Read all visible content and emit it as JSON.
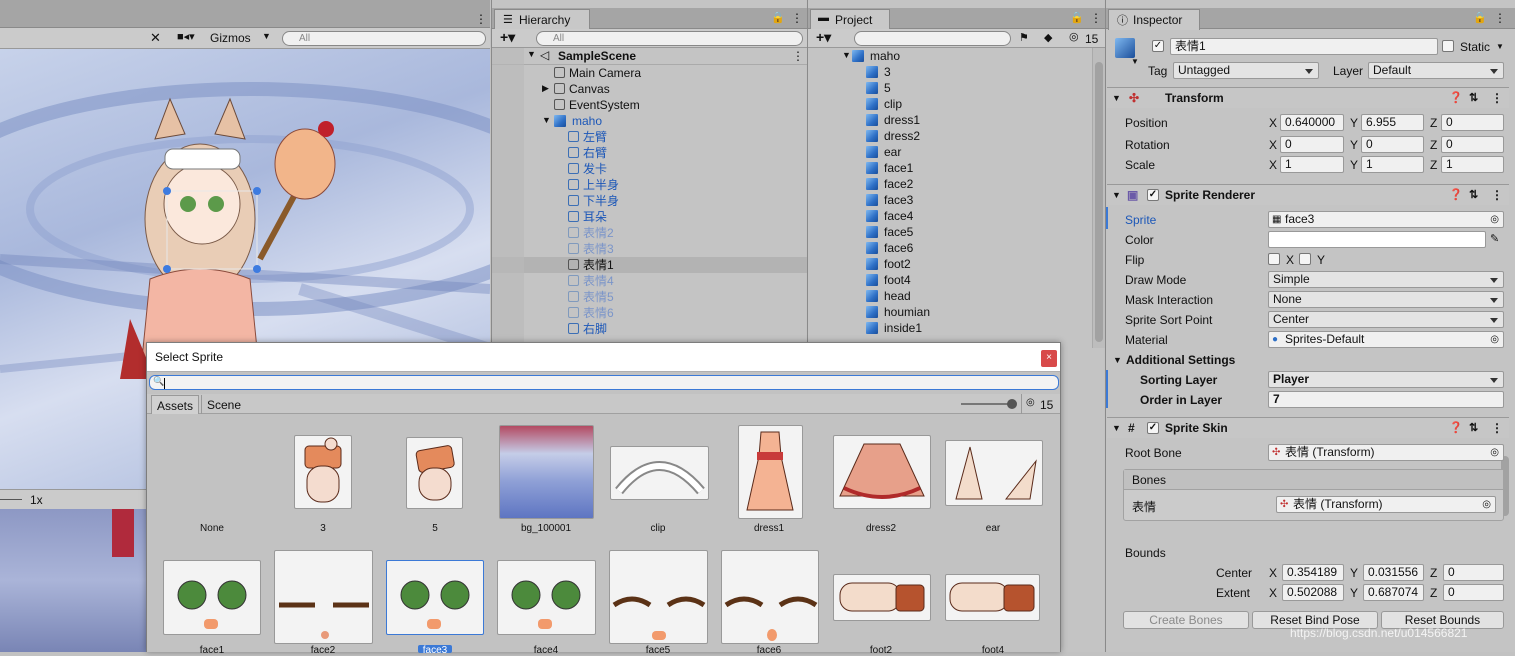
{
  "scene": {
    "gizmos_label": "Gizmos",
    "search_placeholder": "All",
    "zoom_label": "1x"
  },
  "hierarchy": {
    "tab": "Hierarchy",
    "search_placeholder": "All",
    "scene_name": "SampleScene",
    "items": [
      {
        "label": "Main Camera",
        "style": "normal"
      },
      {
        "label": "Canvas",
        "style": "normal"
      },
      {
        "label": "EventSystem",
        "style": "normal"
      },
      {
        "label": "maho",
        "style": "blue"
      },
      {
        "label": "左臂",
        "style": "blue"
      },
      {
        "label": "右臂",
        "style": "blue"
      },
      {
        "label": "发卡",
        "style": "blue"
      },
      {
        "label": "上半身",
        "style": "blue"
      },
      {
        "label": "下半身",
        "style": "blue"
      },
      {
        "label": "耳朵",
        "style": "blue"
      },
      {
        "label": "表情2",
        "style": "faded"
      },
      {
        "label": "表情3",
        "style": "faded"
      },
      {
        "label": "表情1",
        "style": "selected"
      },
      {
        "label": "表情4",
        "style": "faded"
      },
      {
        "label": "表情5",
        "style": "faded"
      },
      {
        "label": "表情6",
        "style": "faded"
      },
      {
        "label": "右脚",
        "style": "blue"
      }
    ]
  },
  "project": {
    "tab": "Project",
    "count": "15",
    "root": "maho",
    "items": [
      "3",
      "5",
      "clip",
      "dress1",
      "dress2",
      "ear",
      "face1",
      "face2",
      "face3",
      "face4",
      "face5",
      "face6",
      "foot2",
      "foot4",
      "head",
      "houmian",
      "inside1"
    ]
  },
  "inspector": {
    "tab": "Inspector",
    "object_name": "表情1",
    "static_label": "Static",
    "tag_label": "Tag",
    "tag_value": "Untagged",
    "layer_label": "Layer",
    "layer_value": "Default",
    "transform": {
      "title": "Transform",
      "position_label": "Position",
      "px": "0.640000",
      "py": "6.955",
      "pz": "0",
      "rotation_label": "Rotation",
      "rx": "0",
      "ry": "0",
      "rz": "0",
      "scale_label": "Scale",
      "sx": "1",
      "sy": "1",
      "sz": "1"
    },
    "sprite_renderer": {
      "title": "Sprite Renderer",
      "sprite_label": "Sprite",
      "sprite_value": "face3",
      "color_label": "Color",
      "flip_label": "Flip",
      "flip_x": "X",
      "flip_y": "Y",
      "draw_mode_label": "Draw Mode",
      "draw_mode_value": "Simple",
      "mask_label": "Mask Interaction",
      "mask_value": "None",
      "sort_point_label": "Sprite Sort Point",
      "sort_point_value": "Center",
      "material_label": "Material",
      "material_value": "Sprites-Default",
      "additional_label": "Additional Settings",
      "sorting_layer_label": "Sorting Layer",
      "sorting_layer_value": "Player",
      "order_label": "Order in Layer",
      "order_value": "7"
    },
    "sprite_skin": {
      "title": "Sprite Skin",
      "root_bone_label": "Root Bone",
      "root_bone_value": "表情 (Transform)",
      "bones_label": "Bones",
      "bone_name": "表情",
      "bone_value": "表情 (Transform)",
      "bounds_label": "Bounds",
      "center_label": "Center",
      "cx": "0.354189",
      "cy": "0.031556",
      "cz": "0",
      "extent_label": "Extent",
      "ex": "0.502088",
      "ey": "0.687074",
      "ez": "0",
      "create_bones": "Create Bones",
      "reset_bind": "Reset Bind Pose",
      "reset_bounds": "Reset Bounds"
    },
    "axis": {
      "x": "X",
      "y": "Y",
      "z": "Z"
    }
  },
  "select_sprite": {
    "title": "Select Sprite",
    "close": "×",
    "tab_assets": "Assets",
    "tab_scene": "Scene",
    "count": "15",
    "row1": [
      "None",
      "3",
      "5",
      "bg_100001",
      "clip",
      "dress1",
      "dress2",
      "ear"
    ],
    "row2": [
      "face1",
      "face2",
      "face3",
      "face4",
      "face5",
      "face6",
      "foot2",
      "foot4"
    ]
  },
  "watermark": "https://blog.csdn.net/u014566821"
}
